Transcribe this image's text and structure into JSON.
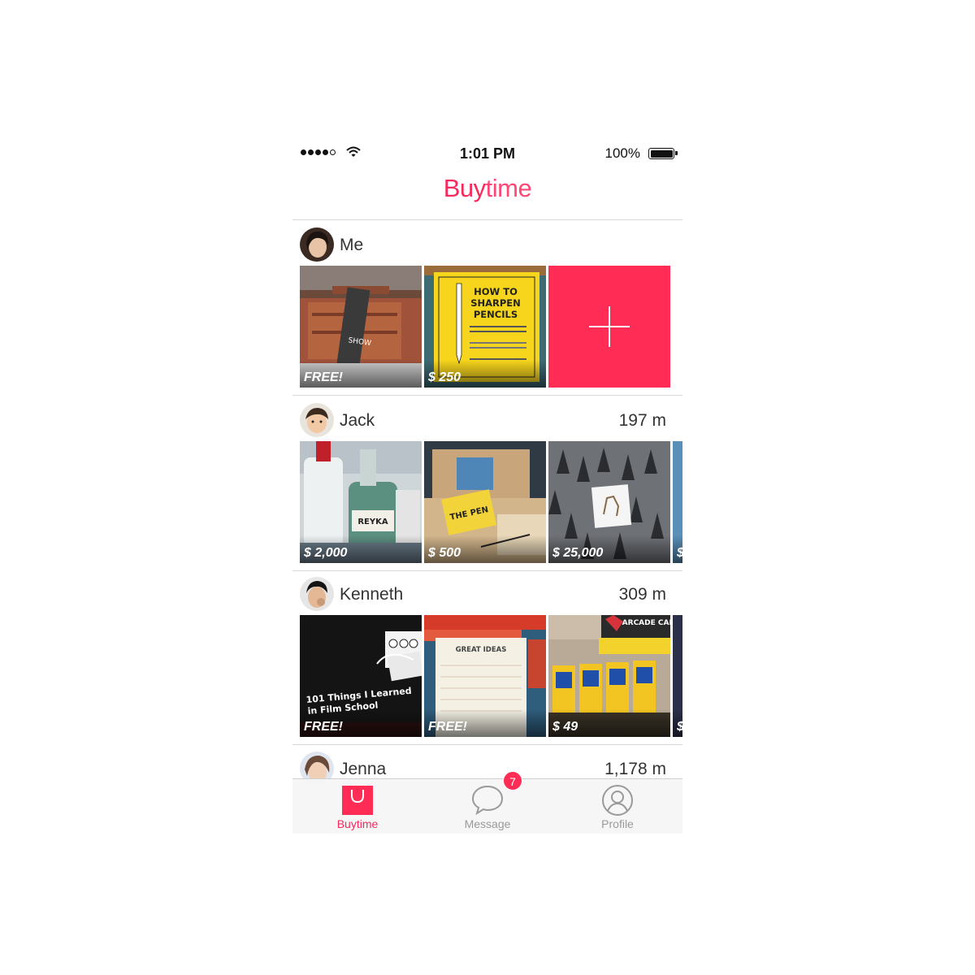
{
  "status_bar": {
    "time": "1:01 PM",
    "battery": "100%"
  },
  "header": {
    "title_bold": "Buy",
    "title_light": "time"
  },
  "sections": [
    {
      "user": "Me",
      "distance": "",
      "items": [
        {
          "price": "FREE!"
        },
        {
          "price": "$ 250"
        }
      ]
    },
    {
      "user": "Jack",
      "distance": "197 m",
      "items": [
        {
          "price": "$ 2,000"
        },
        {
          "price": "$ 500"
        },
        {
          "price": "$ 25,000"
        },
        {
          "price": "$"
        }
      ]
    },
    {
      "user": "Kenneth",
      "distance": "309 m",
      "items": [
        {
          "price": "FREE!"
        },
        {
          "price": "FREE!"
        },
        {
          "price": "$ 49"
        },
        {
          "price": "$"
        }
      ]
    },
    {
      "user": "Jenna",
      "distance": "1,178 m",
      "items": []
    }
  ],
  "tiles_text": {
    "sharpen_book": "HOW TO SHARPEN PENCILS",
    "vodka": "REYKA",
    "film_book_line1": "101 Things I Learned",
    "film_book_line2": "in Film School",
    "notepad": "GREAT IDEAS",
    "arcade": "ARCADE CANDY"
  },
  "tabbar": {
    "tabs": [
      {
        "label": "Buytime",
        "icon": "shopping-bag-icon",
        "active": true
      },
      {
        "label": "Message",
        "icon": "chat-bubble-icon",
        "active": false,
        "badge": "7"
      },
      {
        "label": "Profile",
        "icon": "profile-icon",
        "active": false
      }
    ]
  },
  "colors": {
    "accent": "#ff2d55",
    "title": "#f7295d",
    "text": "#333333",
    "inactive_tab": "#9a9a9a"
  }
}
